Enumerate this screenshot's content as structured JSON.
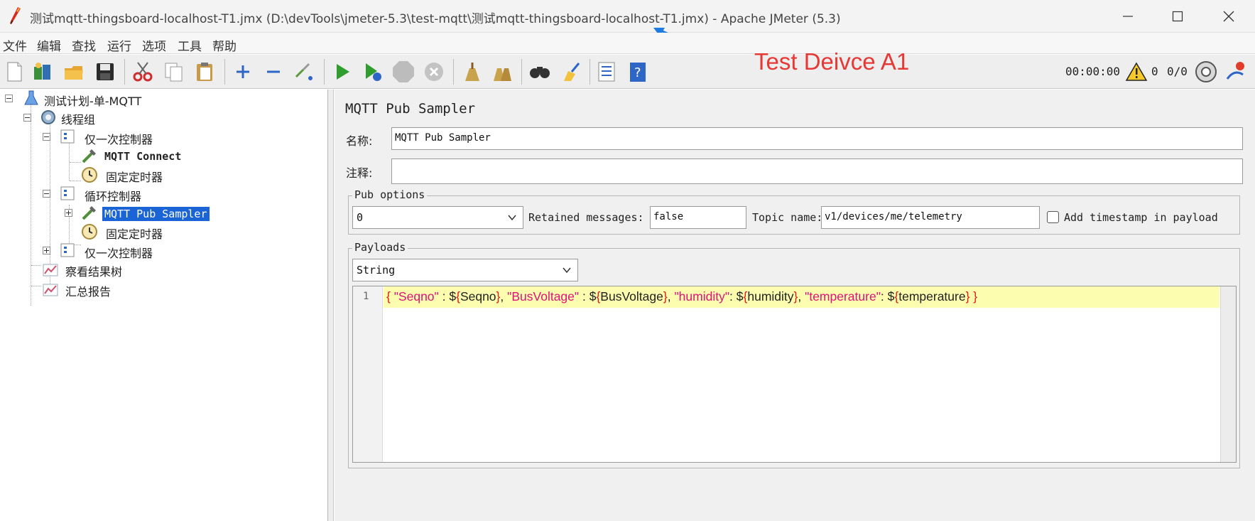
{
  "window": {
    "title": "测试mqtt-thingsboard-localhost-T1.jmx (D:\\devTools\\jmeter-5.3\\test-mqtt\\测试mqtt-thingsboard-localhost-T1.jmx) - Apache JMeter (5.3)"
  },
  "menu": {
    "items": [
      {
        "label": "文件",
        "underline": "F"
      },
      {
        "label": "编辑"
      },
      {
        "label": "查找"
      },
      {
        "label": "运行"
      },
      {
        "label": "选项"
      },
      {
        "label": "工具"
      },
      {
        "label": "帮助"
      }
    ]
  },
  "toolbar": {
    "overlay_text": "Test Deivce A1",
    "timer": "00:00:00",
    "warnings": "0",
    "threads": "0/0",
    "icons": [
      "new-icon",
      "templates-icon",
      "open-icon",
      "save-icon",
      "cut-icon",
      "copy-icon",
      "paste-icon",
      "expand-icon",
      "collapse-icon",
      "toggle-icon",
      "start-icon",
      "start-no-pause-icon",
      "stop-icon",
      "shutdown-icon",
      "clear-icon",
      "clear-all-icon",
      "search-icon",
      "reset-search-icon",
      "function-helper-icon",
      "help-icon"
    ]
  },
  "tree": {
    "nodes": [
      {
        "label": "测试计划-单-MQTT",
        "icon": "test-plan-icon"
      },
      {
        "label": "线程组",
        "icon": "thread-group-icon"
      },
      {
        "label": "仅一次控制器",
        "icon": "controller-icon"
      },
      {
        "label": "MQTT Connect",
        "icon": "sampler-icon"
      },
      {
        "label": "固定定时器",
        "icon": "timer-icon"
      },
      {
        "label": "循环控制器",
        "icon": "controller-icon"
      },
      {
        "label": "MQTT Pub Sampler",
        "icon": "sampler-icon",
        "selected": true
      },
      {
        "label": "固定定时器",
        "icon": "timer-icon"
      },
      {
        "label": "仅一次控制器",
        "icon": "controller-icon"
      },
      {
        "label": "察看结果树",
        "icon": "listener-icon"
      },
      {
        "label": "汇总报告",
        "icon": "listener-icon"
      }
    ]
  },
  "sampler": {
    "title": "MQTT Pub Sampler",
    "name_label": "名称:",
    "name_value": "MQTT Pub Sampler",
    "comment_label": "注释:",
    "comment_value": "",
    "pub_options": {
      "legend": "Pub options",
      "qos_value": "0",
      "retained_label": "Retained messages:",
      "retained_value": "false",
      "topic_label": "Topic name:",
      "topic_value": "v1/devices/me/telemetry",
      "timestamp_label": "Add timestamp in payload",
      "timestamp_checked": false
    },
    "payloads": {
      "legend": "Payloads",
      "type_value": "String",
      "line_number": "1",
      "tokens": [
        {
          "t": "{ ",
          "c": "brace"
        },
        {
          "t": "\"Seqno\"",
          "c": "str"
        },
        {
          "t": " : $",
          "c": "plain"
        },
        {
          "t": "{",
          "c": "brace"
        },
        {
          "t": "Seqno",
          "c": "plain"
        },
        {
          "t": "}",
          "c": "brace"
        },
        {
          "t": ", ",
          "c": "plain"
        },
        {
          "t": "\"BusVoltage\"",
          "c": "str"
        },
        {
          "t": " : $",
          "c": "plain"
        },
        {
          "t": "{",
          "c": "brace"
        },
        {
          "t": "BusVoltage",
          "c": "plain"
        },
        {
          "t": "}",
          "c": "brace"
        },
        {
          "t": ", ",
          "c": "plain"
        },
        {
          "t": "\"humidity\"",
          "c": "str"
        },
        {
          "t": ": $",
          "c": "plain"
        },
        {
          "t": "{",
          "c": "brace"
        },
        {
          "t": "humidity",
          "c": "plain"
        },
        {
          "t": "}",
          "c": "brace"
        },
        {
          "t": ", ",
          "c": "plain"
        },
        {
          "t": "\"temperature\"",
          "c": "str"
        },
        {
          "t": ": $",
          "c": "plain"
        },
        {
          "t": "{",
          "c": "brace"
        },
        {
          "t": "temperature",
          "c": "plain"
        },
        {
          "t": "} }",
          "c": "brace"
        }
      ]
    }
  },
  "colors": {
    "overlay": "#e53935",
    "selection": "#1a64d6",
    "editor_line_highlight": "#fdfdb0",
    "arrow": "#1e7be0"
  }
}
